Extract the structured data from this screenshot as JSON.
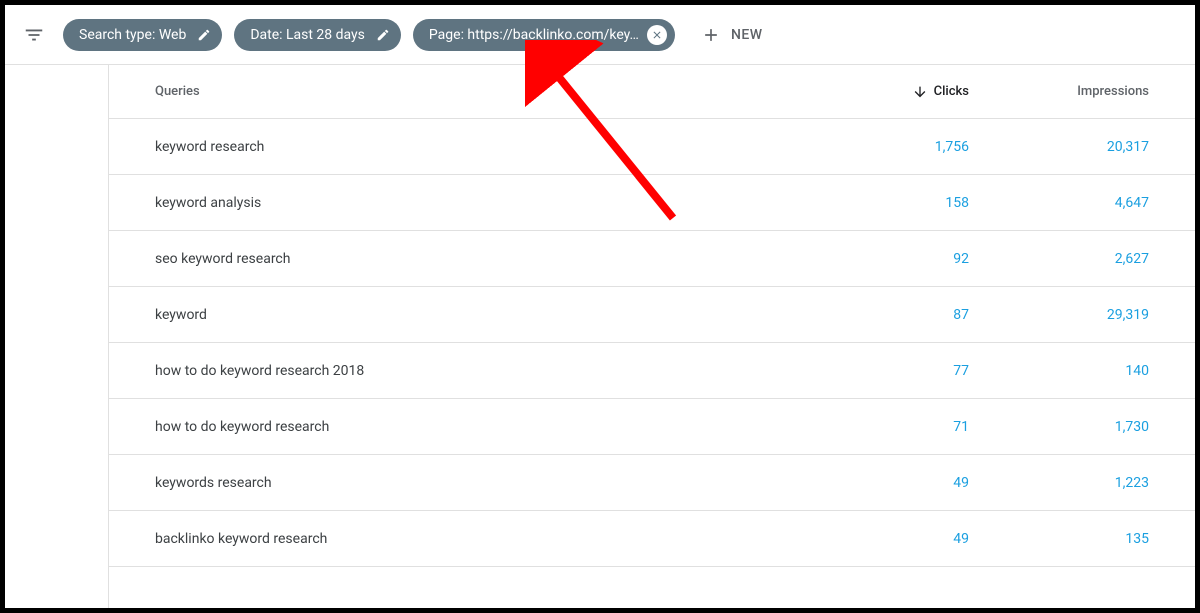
{
  "filters": {
    "search_type": "Search type: Web",
    "date": "Date: Last 28 days",
    "page": "Page: https://backlinko.com/key…",
    "new_label": "NEW"
  },
  "headers": {
    "queries": "Queries",
    "clicks": "Clicks",
    "impressions": "Impressions"
  },
  "rows": [
    {
      "query": "keyword research",
      "clicks": "1,756",
      "impressions": "20,317"
    },
    {
      "query": "keyword analysis",
      "clicks": "158",
      "impressions": "4,647"
    },
    {
      "query": "seo keyword research",
      "clicks": "92",
      "impressions": "2,627"
    },
    {
      "query": "keyword",
      "clicks": "87",
      "impressions": "29,319"
    },
    {
      "query": "how to do keyword research 2018",
      "clicks": "77",
      "impressions": "140"
    },
    {
      "query": "how to do keyword research",
      "clicks": "71",
      "impressions": "1,730"
    },
    {
      "query": "keywords research",
      "clicks": "49",
      "impressions": "1,223"
    },
    {
      "query": "backlinko keyword research",
      "clicks": "49",
      "impressions": "135"
    }
  ]
}
